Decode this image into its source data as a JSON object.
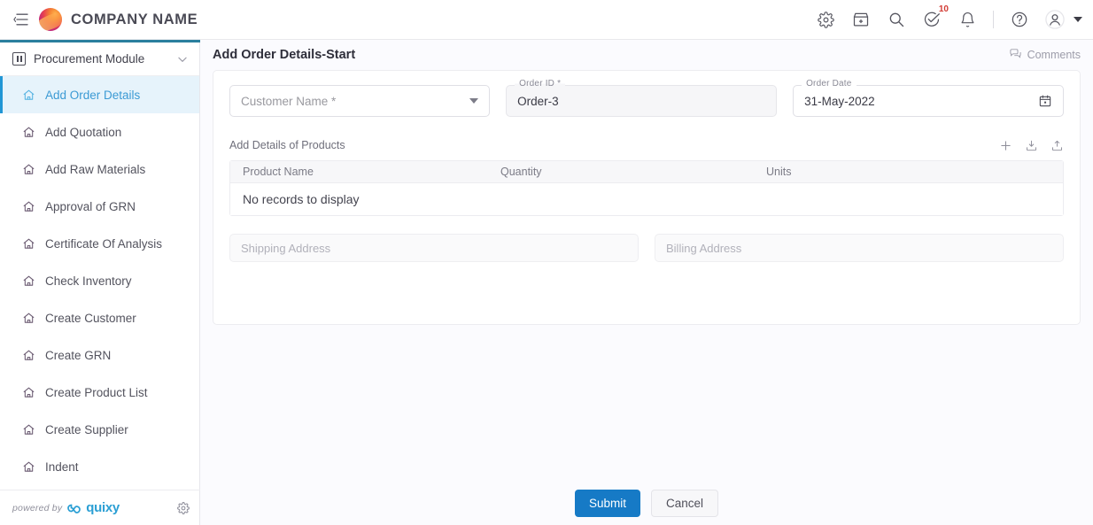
{
  "topbar": {
    "menu_icon": "hamburger-icon",
    "brand": "COMPANY NAME",
    "icons": [
      {
        "name": "gear-icon",
        "label": "Settings"
      },
      {
        "name": "store-icon",
        "label": "App Store"
      },
      {
        "name": "search-icon",
        "label": "Search"
      },
      {
        "name": "tasks-check-icon",
        "label": "Tasks",
        "badge": "10"
      },
      {
        "name": "bell-icon",
        "label": "Notifications"
      },
      {
        "name": "help-icon",
        "label": "Help"
      },
      {
        "name": "user-avatar-icon",
        "label": "Account"
      }
    ]
  },
  "sidebar": {
    "module": {
      "title": "Procurement Module",
      "icon": "module-grid-icon",
      "chevron": "chevron-down-icon"
    },
    "items": [
      {
        "label": "Add Order Details",
        "active": true
      },
      {
        "label": "Add Quotation",
        "active": false
      },
      {
        "label": "Add Raw Materials",
        "active": false
      },
      {
        "label": "Approval of GRN",
        "active": false
      },
      {
        "label": "Certificate Of Analysis",
        "active": false
      },
      {
        "label": "Check Inventory",
        "active": false
      },
      {
        "label": "Create Customer",
        "active": false
      },
      {
        "label": "Create GRN",
        "active": false
      },
      {
        "label": "Create Product List",
        "active": false
      },
      {
        "label": "Create Supplier",
        "active": false
      },
      {
        "label": "Indent",
        "active": false
      }
    ],
    "footer": {
      "powered_by": "powered by",
      "product": "quixy",
      "settings_icon": "gear-icon"
    }
  },
  "main": {
    "page_title": "Add Order Details-Start",
    "comments_label": "Comments",
    "form": {
      "customer_name": {
        "legend": "",
        "placeholder": "Customer Name *",
        "value": ""
      },
      "order_id": {
        "legend": "Order ID *",
        "value": "Order-3"
      },
      "order_date": {
        "legend": "Order Date",
        "value": "31-May-2022"
      },
      "products_section_label": "Add Details of Products",
      "products_actions": [
        "add-row-icon",
        "download-icon",
        "upload-icon"
      ],
      "table": {
        "columns": [
          "Product Name",
          "Quantity",
          "Units"
        ],
        "rows": [],
        "empty_message": "No records to display"
      },
      "shipping_address": {
        "placeholder": "Shipping Address",
        "value": ""
      },
      "billing_address": {
        "placeholder": "Billing Address",
        "value": ""
      }
    },
    "buttons": {
      "submit": "Submit",
      "cancel": "Cancel"
    }
  },
  "colors": {
    "accent_bar": "#2a7f9e",
    "active_item_bg": "#e6f3fb",
    "active_item_text": "#3b9ad4",
    "primary_button": "#167ac6",
    "badge_text": "#d23b34",
    "brand_blue": "#2b9fd4"
  }
}
